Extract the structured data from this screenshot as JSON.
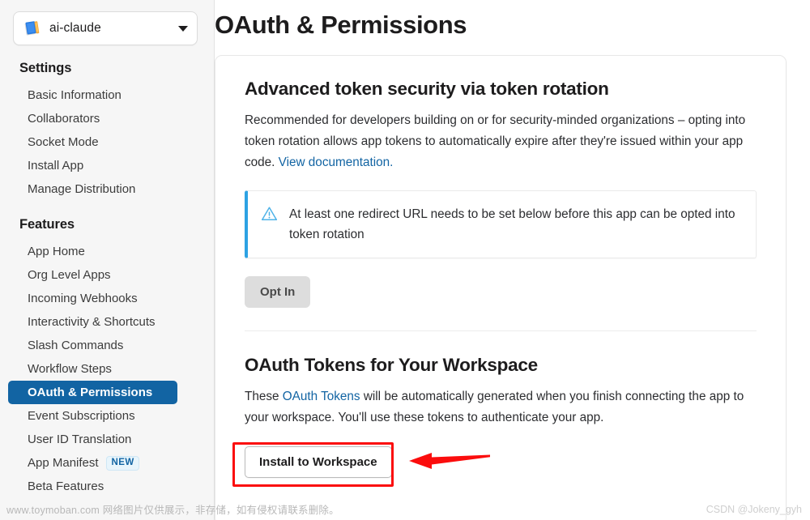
{
  "sidebar": {
    "app_selector": {
      "name": "ai-claude",
      "icon": "app-book-icon",
      "caret": "chevron-down-icon"
    },
    "groups": [
      {
        "heading": "Settings",
        "items": [
          {
            "label": "Basic Information",
            "active": false
          },
          {
            "label": "Collaborators",
            "active": false
          },
          {
            "label": "Socket Mode",
            "active": false
          },
          {
            "label": "Install App",
            "active": false
          },
          {
            "label": "Manage Distribution",
            "active": false
          }
        ]
      },
      {
        "heading": "Features",
        "items": [
          {
            "label": "App Home",
            "active": false
          },
          {
            "label": "Org Level Apps",
            "active": false
          },
          {
            "label": "Incoming Webhooks",
            "active": false
          },
          {
            "label": "Interactivity & Shortcuts",
            "active": false
          },
          {
            "label": "Slash Commands",
            "active": false
          },
          {
            "label": "Workflow Steps",
            "active": false
          },
          {
            "label": "OAuth & Permissions",
            "active": true
          },
          {
            "label": "Event Subscriptions",
            "active": false
          },
          {
            "label": "User ID Translation",
            "active": false
          },
          {
            "label": "App Manifest",
            "active": false,
            "badge": "NEW"
          },
          {
            "label": "Beta Features",
            "active": false
          }
        ]
      }
    ]
  },
  "main": {
    "page_title": "OAuth & Permissions",
    "sections": [
      {
        "title": "Advanced token security via token rotation",
        "body_part1": "Recommended for developers building on or for security-minded organizations – opting into token rotation allows app tokens to automatically expire after they're issued within your app code. ",
        "link_text": "View documentation.",
        "alert": {
          "icon": "warning-triangle-icon",
          "text": "At least one redirect URL needs to be set below before this app can be opted into token rotation"
        },
        "button": "Opt In"
      },
      {
        "title": "OAuth Tokens for Your Workspace",
        "body_prefix": "These ",
        "link_text": "OAuth Tokens",
        "body_suffix": " will be automatically generated when you finish connecting the app to your workspace. You'll use these tokens to authenticate your app.",
        "button": "Install to Workspace"
      }
    ]
  },
  "annotations": {
    "highlight_box_color": "#fb0d0d",
    "arrow_color": "#fb0d0d",
    "arrow_direction": "left"
  },
  "watermarks": {
    "left": "www.toymoban.com 网络图片仅供展示，非存储，如有侵权请联系删除。",
    "right": "CSDN @Jokeny_gyh"
  },
  "colors": {
    "accent_blue": "#1264a3",
    "alert_blue": "#2da2e3",
    "annotation_red": "#fb0d0d",
    "sidebar_bg": "#f6f6f6"
  }
}
